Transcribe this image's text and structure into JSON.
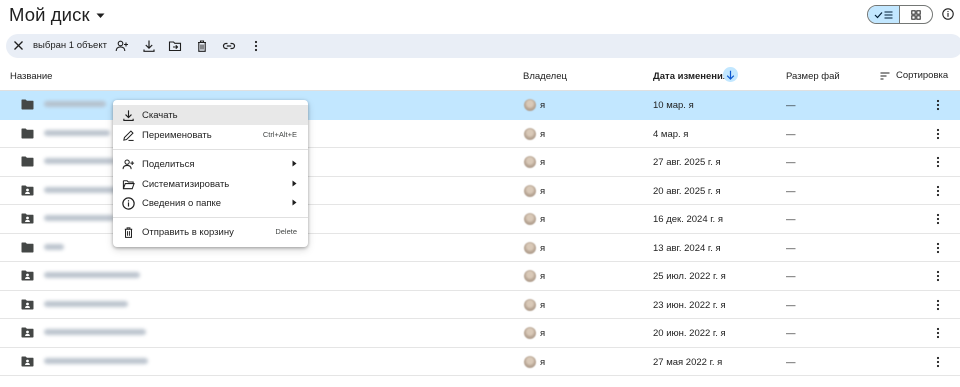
{
  "header": {
    "title": "Мой диск"
  },
  "toolbar": {
    "selection_text": "выбран 1 объект"
  },
  "table": {
    "columns": {
      "name": "Название",
      "owner": "Владелец",
      "modified": "Дата изменения",
      "size": "Размер фай",
      "sort": "Сортировка"
    },
    "rows": [
      {
        "owner": "я",
        "date": "10 мар. я",
        "size": "—",
        "icon": "folder-icon"
      },
      {
        "owner": "я",
        "date": "4 мар. я",
        "size": "—",
        "icon": "folder-icon"
      },
      {
        "owner": "я",
        "date": "27 авг. 2025 г. я",
        "size": "—",
        "icon": "folder-icon"
      },
      {
        "owner": "я",
        "date": "20 авг. 2025 г. я",
        "size": "—",
        "icon": "shared-folder-icon"
      },
      {
        "owner": "я",
        "date": "16 дек. 2024 г. я",
        "size": "—",
        "icon": "shared-folder-icon"
      },
      {
        "owner": "я",
        "date": "13 авг. 2024 г. я",
        "size": "—",
        "icon": "folder-icon"
      },
      {
        "owner": "я",
        "date": "25 июл. 2022 г. я",
        "size": "—",
        "icon": "shared-folder-icon"
      },
      {
        "owner": "я",
        "date": "23 июн. 2022 г. я",
        "size": "—",
        "icon": "shared-folder-icon"
      },
      {
        "owner": "я",
        "date": "20 июн. 2022 г. я",
        "size": "—",
        "icon": "shared-folder-icon"
      },
      {
        "owner": "я",
        "date": "27 мая 2022 г. я",
        "size": "—",
        "icon": "shared-folder-icon"
      }
    ]
  },
  "context_menu": {
    "download": "Скачать",
    "rename": "Переименовать",
    "rename_shortcut": "Ctrl+Alt+E",
    "share": "Поделиться",
    "organize": "Систематизировать",
    "folder_info": "Сведения о папке",
    "trash": "Отправить в корзину",
    "trash_shortcut": "Delete"
  },
  "colors": {
    "selected_row": "#c2e7ff",
    "toolbar_bg": "#e9eef6",
    "hover": "#e8e8e8"
  }
}
